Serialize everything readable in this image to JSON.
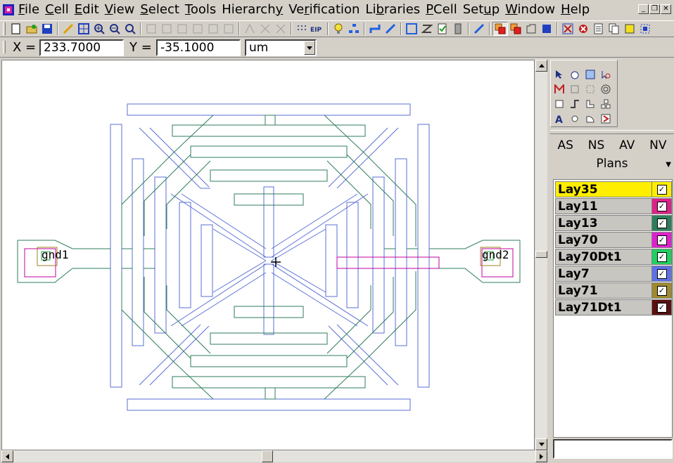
{
  "menu": {
    "items": [
      {
        "pre": "",
        "ul": "F",
        "post": "ile"
      },
      {
        "pre": "",
        "ul": "C",
        "post": "ell"
      },
      {
        "pre": "",
        "ul": "E",
        "post": "dit"
      },
      {
        "pre": "",
        "ul": "V",
        "post": "iew"
      },
      {
        "pre": "",
        "ul": "S",
        "post": "elect"
      },
      {
        "pre": "",
        "ul": "T",
        "post": "ools"
      },
      {
        "pre": "Hierarch",
        "ul": "y",
        "post": ""
      },
      {
        "pre": "Ve",
        "ul": "r",
        "post": "ification"
      },
      {
        "pre": "Li",
        "ul": "b",
        "post": "raries"
      },
      {
        "pre": "",
        "ul": "P",
        "post": "Cell"
      },
      {
        "pre": "Set",
        "ul": "u",
        "post": "p"
      },
      {
        "pre": "",
        "ul": "W",
        "post": "indow"
      },
      {
        "pre": "",
        "ul": "H",
        "post": "elp"
      }
    ]
  },
  "coords": {
    "x_label": "X =",
    "x_value": "233.7000",
    "y_label": "Y =",
    "y_value": "-35.1000",
    "unit": "um"
  },
  "canvas": {
    "port_left": "gnd1",
    "port_right": "gnd2",
    "colors": {
      "metal_blue": "#5a6fd6",
      "metal_green": "#2e7d5b",
      "via_magenta": "#c000a0",
      "port_olive": "#a08020"
    }
  },
  "panel": {
    "tabs": [
      "AS",
      "NS",
      "AV",
      "NV"
    ],
    "plans_label": "Plans",
    "layers": [
      {
        "name": "Lay35",
        "color": "#ffee00",
        "checked": true
      },
      {
        "name": "Lay11",
        "color": "#e0208a",
        "checked": true
      },
      {
        "name": "Lay13",
        "color": "#2e7d5b",
        "checked": true
      },
      {
        "name": "Lay70",
        "color": "#e020d0",
        "checked": true
      },
      {
        "name": "Lay70Dt1",
        "color": "#20d060",
        "checked": true
      },
      {
        "name": "Lay7",
        "color": "#6070e8",
        "checked": true
      },
      {
        "name": "Lay71",
        "color": "#a08a30",
        "checked": true
      },
      {
        "name": "Lay71Dt1",
        "color": "#5a1010",
        "checked": true
      }
    ]
  }
}
